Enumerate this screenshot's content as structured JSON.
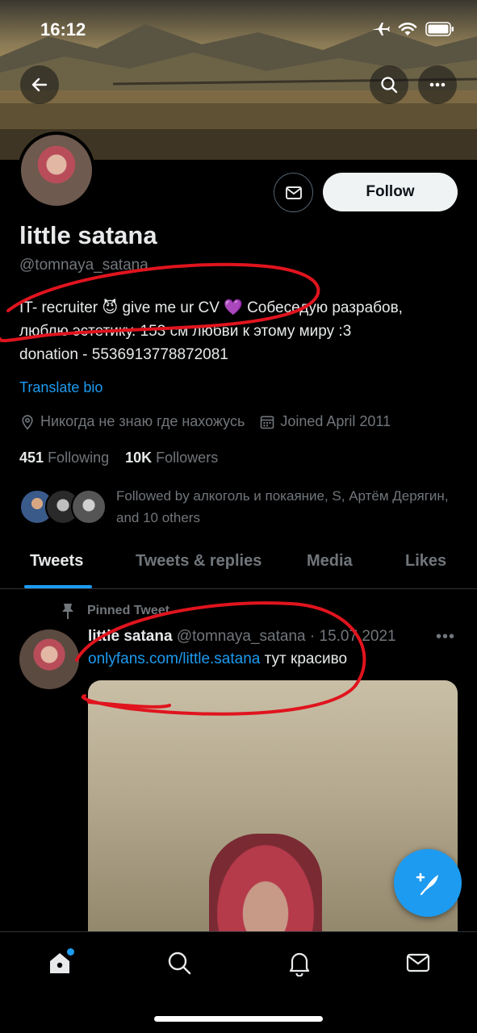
{
  "status_bar": {
    "time": "16:12"
  },
  "header": {
    "back_icon": "arrow-left-icon",
    "search_icon": "search-icon",
    "more_icon": "more-horizontal-icon"
  },
  "profile": {
    "display_name": "little satana",
    "handle": "@tomnaya_satana",
    "bio_lines": [
      "IT- recruiter 😈 give me ur CV 💜 Собеседую разрабов,",
      "люблю эстетику. 153 см любви к этому миру :3",
      "donation - 5536913778872081"
    ],
    "translate_label": "Translate bio",
    "location": "Никогда не знаю где нахожусь",
    "joined": "Joined April 2011",
    "following_count": "451",
    "following_label": "Following",
    "followers_count": "10K",
    "followers_label": "Followers",
    "followed_by": "Followed by алкоголь и покаяние, S, Артём Дерягин, and 10 others",
    "follow_label": "Follow"
  },
  "tabs": [
    {
      "label": "Tweets",
      "active": true
    },
    {
      "label": "Tweets & replies",
      "active": false
    },
    {
      "label": "Media",
      "active": false
    },
    {
      "label": "Likes",
      "active": false
    }
  ],
  "pinned_tweet": {
    "pinned_label": "Pinned Tweet",
    "author_name": "little satana",
    "author_handle": "@tomnaya_satana",
    "date": "· 15.07.2021",
    "link_text": "onlyfans.com/little.satana",
    "text": " тут красиво",
    "more": "•••"
  },
  "colors": {
    "accent": "#1d9bf0",
    "background": "#000000",
    "annotation_red": "#e0141e"
  }
}
